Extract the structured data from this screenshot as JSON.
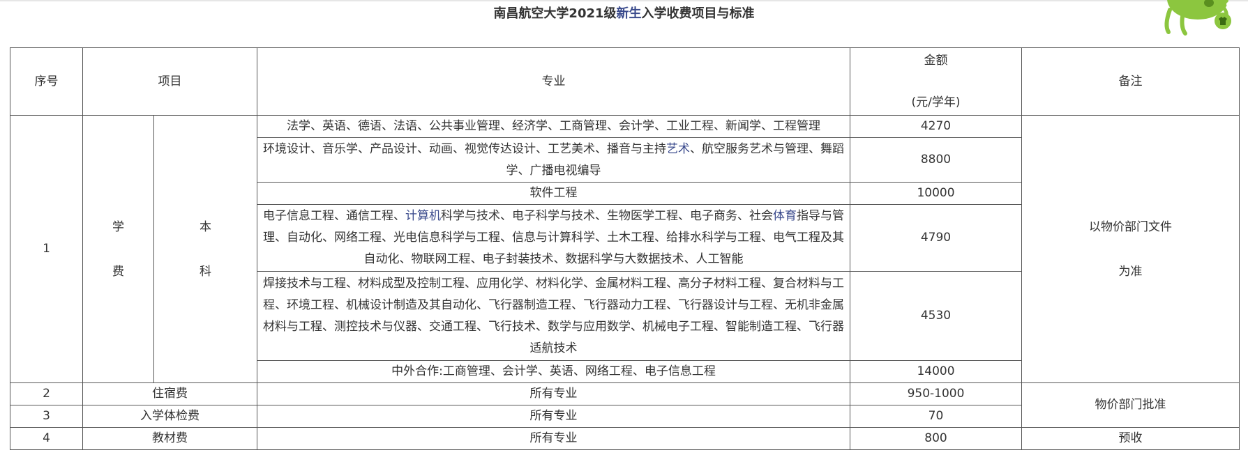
{
  "title": {
    "pre": "南昌航空大学2021级",
    "link": "新生",
    "post": "入学收费项目与标准"
  },
  "header": {
    "no": "序号",
    "item": "项目",
    "major": "专业",
    "amount_line1": "金额",
    "amount_line2": "(元/学年)",
    "note": "备注"
  },
  "tuition": {
    "no": "1",
    "item_chars": [
      "学",
      "费"
    ],
    "level_chars": [
      "本",
      "科"
    ],
    "note_lines": [
      "以物价部门文件",
      "为准"
    ],
    "rows": [
      {
        "major": "法学、英语、德语、法语、公共事业管理、经济学、工商管理、会计学、工业工程、新闻学、工程管理",
        "amount": "4270"
      },
      {
        "major_pre": "环境设计、音乐学、产品设计、动画、视觉传达设计、工艺美术、播音与主持",
        "major_link": "艺术",
        "major_post": "、航空服务艺术与管理、舞蹈学、广播电视编导",
        "amount": "8800"
      },
      {
        "major": "软件工程",
        "amount": "10000"
      },
      {
        "major_a": "电子信息工程、通信工程、",
        "major_link1": "计算机",
        "major_b": "科学与技术、电子科学与技术、生物医学工程、电子商务、社会",
        "major_link2": "体育",
        "major_c": "指导与管理、自动化、网络工程、光电信息科学与工程、信息与计算科学、土木工程、给排水科学与工程、电气工程及其自动化、物联网工程、电子封装技术、数据科学与大数据技术、人工智能",
        "amount": "4790"
      },
      {
        "major": "焊接技术与工程、材料成型及控制工程、应用化学、材料化学、金属材料工程、高分子材料工程、复合材料与工程、环境工程、机械设计制造及其自动化、飞行器制造工程、飞行器动力工程、飞行器设计与工程、无机非金属材料与工程、测控技术与仪器、交通工程、飞行技术、数学与应用数学、机械电子工程、智能制造工程、飞行器适航技术",
        "amount": "4530"
      },
      {
        "major": "中外合作:工商管理、会计学、英语、网络工程、电子信息工程",
        "amount": "14000"
      }
    ]
  },
  "others": [
    {
      "no": "2",
      "item": "住宿费",
      "major": "所有专业",
      "amount": "950-1000"
    },
    {
      "no": "3",
      "item": "入学体检费",
      "major": "所有专业",
      "amount": "70"
    },
    {
      "no": "4",
      "item": "教材费",
      "major": "所有专业",
      "amount": "800"
    }
  ],
  "other_notes": {
    "rows_2_3": "物价部门批准",
    "row_4": "预收"
  },
  "mascot": {
    "icon": "green-cartoon-mascot",
    "color": "#8cc63f"
  }
}
